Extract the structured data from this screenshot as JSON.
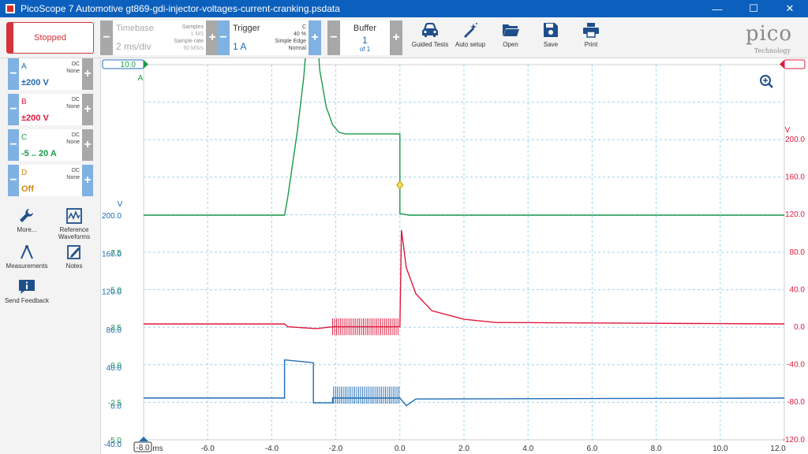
{
  "window": {
    "title": "PicoScope 7 Automotive gt869-gdi-injector-voltages-current-cranking.psdata",
    "min_glyph": "—",
    "max_glyph": "☐",
    "close_glyph": "✕"
  },
  "toolbar": {
    "run_state": "Stopped",
    "timebase": {
      "label": "Timebase",
      "value": "2 ms/div",
      "samples_label": "Samples",
      "samples": "1 MS",
      "rate_label": "Sample rate",
      "rate": "50 MS/s"
    },
    "trigger": {
      "label": "Trigger",
      "value": "1 A",
      "channel": "C",
      "position": "40 %",
      "type": "Simple Edge",
      "mode": "Normal"
    },
    "buffer": {
      "label": "Buffer",
      "value": "1",
      "of": "of 1"
    },
    "buttons": [
      {
        "label": "Guided Tests",
        "icon": "car-icon"
      },
      {
        "label": "Auto setup",
        "icon": "magic-wand-icon"
      },
      {
        "label": "Open",
        "icon": "folder-icon"
      },
      {
        "label": "Save",
        "icon": "floppy-icon"
      },
      {
        "label": "Print",
        "icon": "printer-icon"
      }
    ],
    "logo": {
      "word": "pico",
      "sub": "Technology"
    },
    "minus": "−",
    "plus": "+"
  },
  "channels": [
    {
      "name": "A",
      "range": "±200 V",
      "coupling": "DC",
      "filter": "None",
      "color": "#1f6bb4"
    },
    {
      "name": "B",
      "range": "±200 V",
      "coupling": "DC",
      "filter": "None",
      "color": "#e0183c"
    },
    {
      "name": "C",
      "range": "-5 .. 20 A",
      "coupling": "DC",
      "filter": "None",
      "color": "#1a9a4a"
    },
    {
      "name": "D",
      "range": "Off",
      "coupling": "DC",
      "filter": "None",
      "color": "#d08a14"
    }
  ],
  "tools": [
    {
      "label": "More...",
      "icon": "wrench-icon"
    },
    {
      "label": "Reference Waveforms",
      "icon": "waveform-icon"
    },
    {
      "label": "Measurements",
      "icon": "caliper-icon"
    },
    {
      "label": "Notes",
      "icon": "notes-icon"
    },
    {
      "label": "Send Feedback",
      "icon": "feedback-icon"
    }
  ],
  "scope": {
    "axis_c_unit": "A",
    "axis_a_unit": "V",
    "axis_b_unit": "V",
    "x_unit": "ms",
    "axis_c_marker": "10.0",
    "x_start_marker": "-8.0",
    "zoom_icon": "zoom-in-icon",
    "x_ticks": [
      "-6.0",
      "-4.0",
      "-2.0",
      "0.0",
      "2.0",
      "4.0",
      "6.0",
      "8.0",
      "10.0",
      "12.0"
    ],
    "axis_c_ticks": [
      "7.5",
      "5.0",
      "2.5",
      "0.0",
      "-2.5",
      "-5.0"
    ],
    "axis_a_ticks": [
      "200.0",
      "160.0",
      "120.0",
      "80.0",
      "40.0",
      "0.0",
      "-40.0"
    ],
    "axis_b_ticks": [
      "200.0",
      "160.0",
      "120.0",
      "80.0",
      "40.0",
      "0.0",
      "-40.0",
      "-80.0",
      "-120.0"
    ],
    "grid_color": "#9fd4e8"
  },
  "chart_data": {
    "type": "line",
    "x_range": [
      -8.0,
      12.0
    ],
    "x_unit": "ms",
    "series": [
      {
        "name": "C",
        "unit": "A",
        "range": [
          -5,
          20
        ],
        "color": "#1a9a4a",
        "points": [
          [
            -8.0,
            0.0
          ],
          [
            -3.6,
            0.0
          ],
          [
            -3.5,
            0.6
          ],
          [
            -3.2,
            2.8
          ],
          [
            -3.0,
            4.6
          ],
          [
            -2.8,
            7.2
          ],
          [
            -2.7,
            9.0
          ],
          [
            -2.65,
            7.0
          ],
          [
            -2.5,
            4.8
          ],
          [
            -2.3,
            3.6
          ],
          [
            -2.1,
            3.0
          ],
          [
            -1.9,
            2.75
          ],
          [
            -1.7,
            2.7
          ],
          [
            0.0,
            2.7
          ],
          [
            0.0,
            0.05
          ],
          [
            0.3,
            0.0
          ],
          [
            12.0,
            0.0
          ]
        ]
      },
      {
        "name": "A",
        "unit": "V",
        "range": [
          -200,
          200
        ],
        "color": "#1f6bb4",
        "points": [
          [
            -8.0,
            0.0
          ],
          [
            -3.6,
            0.0
          ],
          [
            -3.6,
            40.0
          ],
          [
            -2.7,
            37.0
          ],
          [
            -2.7,
            -5.0
          ],
          [
            -2.1,
            -5.0
          ],
          [
            -2.1,
            0.0
          ],
          [
            0.0,
            0.0
          ],
          [
            0.2,
            -8.0
          ],
          [
            0.5,
            -1.0
          ],
          [
            12.0,
            0.0
          ]
        ]
      },
      {
        "name": "B",
        "unit": "V",
        "range": [
          -200,
          200
        ],
        "color": "#e0183c",
        "points": [
          [
            -8.0,
            0.0
          ],
          [
            -3.6,
            0.0
          ],
          [
            -3.5,
            -3.0
          ],
          [
            -2.6,
            -5.0
          ],
          [
            -2.1,
            -3.0
          ],
          [
            0.0,
            -3.0
          ],
          [
            0.05,
            100.0
          ],
          [
            0.2,
            60.0
          ],
          [
            0.5,
            32.0
          ],
          [
            1.0,
            14.0
          ],
          [
            2.0,
            5.0
          ],
          [
            3.0,
            1.5
          ],
          [
            12.0,
            0.0
          ]
        ]
      }
    ]
  }
}
